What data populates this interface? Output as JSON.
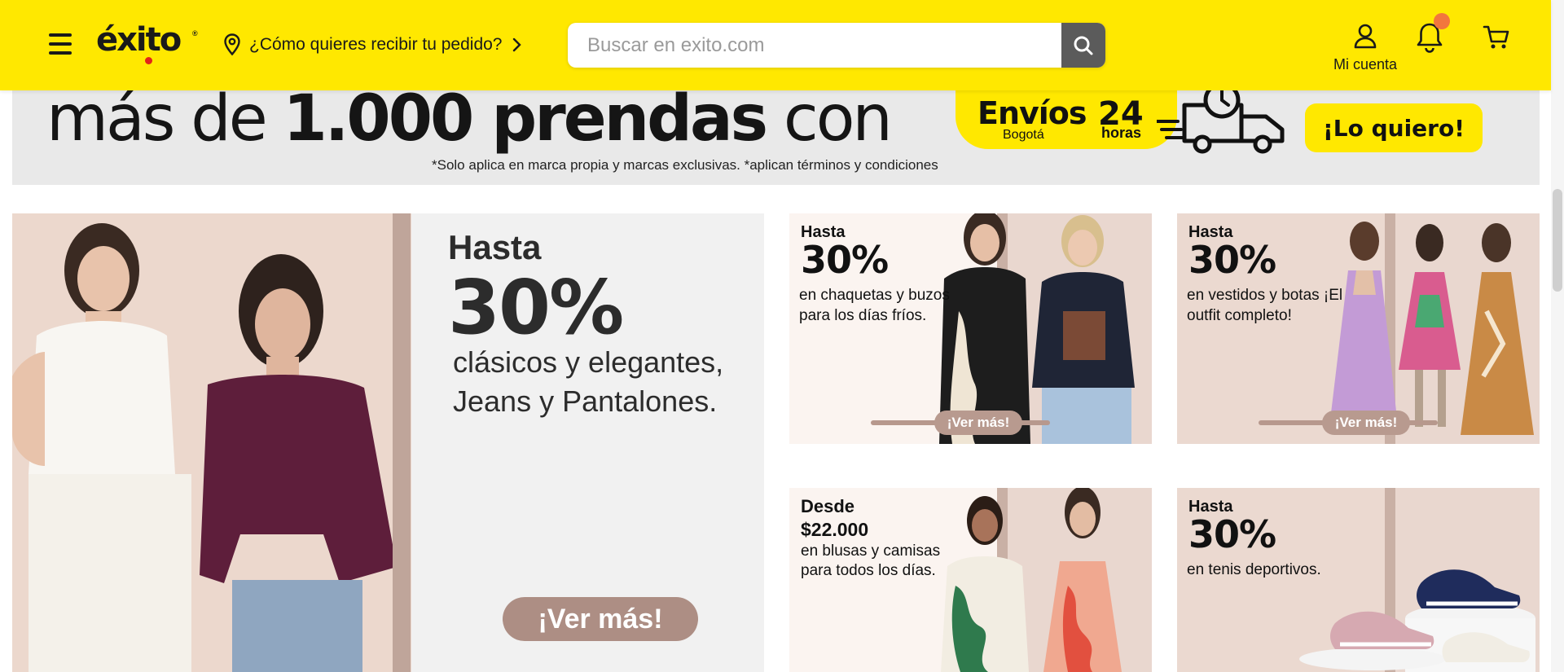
{
  "header": {
    "logo_text": "éxito",
    "delivery_label": "¿Cómo quieres recibir tu pedido?",
    "search_placeholder": "Buscar en exito.com",
    "account_label": "Mi cuenta",
    "icons": [
      "menu-icon",
      "location-pin-icon",
      "chevron-right-icon",
      "search-icon",
      "user-icon",
      "bell-icon",
      "cart-icon"
    ],
    "colors": {
      "brand_yellow": "#ffe800",
      "notification_dot": "#f2763d",
      "search_button": "#5b5b5b"
    }
  },
  "top_banner": {
    "headline_light": "más de",
    "headline_bold": "1.000 prendas",
    "headline_tail": "con",
    "envios": "Envíos",
    "bogota": "Bogotá",
    "hours_number": "24",
    "hours_word": "horas",
    "cta": "¡Lo quiero!",
    "note": "*Solo aplica en marca propia y marcas exclusivas.  *aplican términos y condiciones"
  },
  "big_promo": {
    "hasta": "Hasta",
    "percent": "30%",
    "line1": "clásicos y elegantes,",
    "line2": "Jeans y Pantalones.",
    "cta": "¡Ver más!"
  },
  "promos": [
    {
      "label": "Hasta",
      "percent": "30%",
      "desc": "en chaquetas y buzos para los días fríos.",
      "cta": "¡Ver más!"
    },
    {
      "label": "Hasta",
      "percent": "30%",
      "desc": "en vestidos y botas ¡El outfit completo!",
      "cta": "¡Ver más!"
    },
    {
      "label": "Desde",
      "price": "$22.000",
      "desc": "en blusas y camisas para todos los días."
    },
    {
      "label": "Hasta",
      "percent": "30%",
      "desc": "en tenis deportivos."
    }
  ]
}
